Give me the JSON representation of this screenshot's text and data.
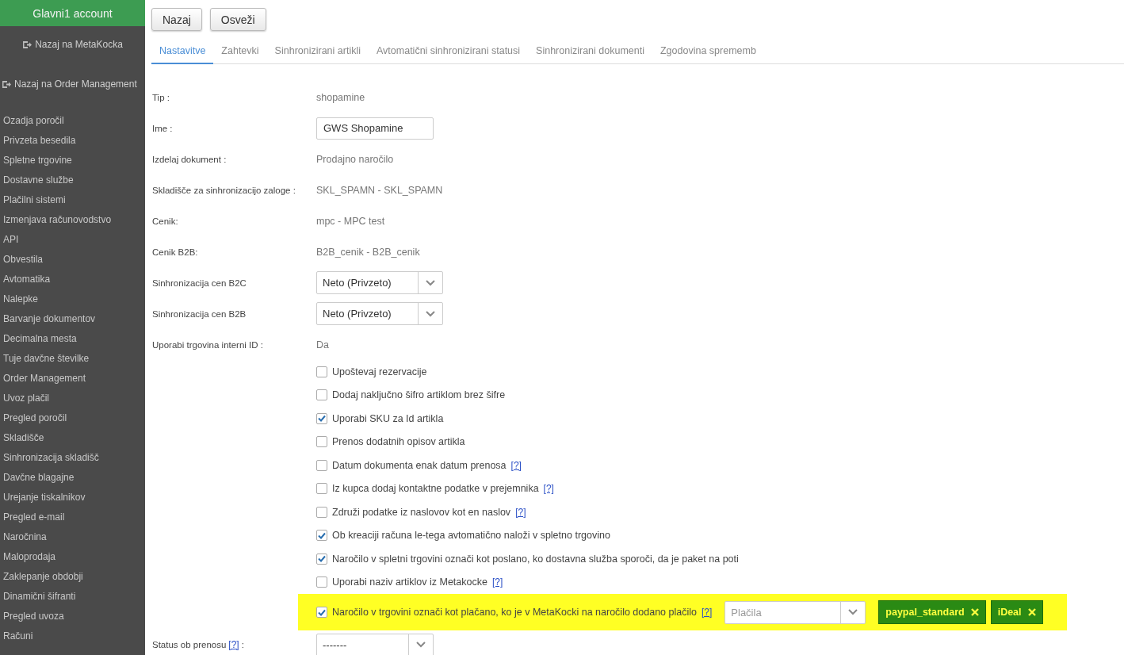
{
  "sidebar": {
    "account": "Glavni1 account",
    "back_links": [
      {
        "label": "Nazaj na MetaKocka"
      },
      {
        "label": "Nazaj na Order Management"
      }
    ],
    "items": [
      {
        "label": "Ozadja poročil"
      },
      {
        "label": "Privzeta besedila"
      },
      {
        "label": "Spletne trgovine"
      },
      {
        "label": "Dostavne službe"
      },
      {
        "label": "Plačilni sistemi"
      },
      {
        "label": "Izmenjava računovodstvo"
      },
      {
        "label": "API"
      },
      {
        "label": "Obvestila"
      },
      {
        "label": "Avtomatika"
      },
      {
        "label": "Nalepke"
      },
      {
        "label": "Barvanje dokumentov"
      },
      {
        "label": "Decimalna mesta"
      },
      {
        "label": "Tuje davčne številke"
      },
      {
        "label": "Order Management"
      },
      {
        "label": "Uvoz plačil"
      },
      {
        "label": "Pregled poročil"
      },
      {
        "label": "Skladišče"
      },
      {
        "label": "Sinhronizacija skladišč"
      },
      {
        "label": "Davčne blagajne"
      },
      {
        "label": "Urejanje tiskalnikov"
      },
      {
        "label": "Pregled e-mail"
      },
      {
        "label": "Naročnina"
      },
      {
        "label": "Maloprodaja"
      },
      {
        "label": "Zaklepanje obdobji"
      },
      {
        "label": "Dinamični šifranti"
      },
      {
        "label": "Pregled uvoza"
      },
      {
        "label": "Računi"
      }
    ]
  },
  "toolbar": {
    "buttons": [
      "Nazaj",
      "Osveži"
    ]
  },
  "tabs": [
    {
      "label": "Nastavitve",
      "selected": true
    },
    {
      "label": "Zahtevki",
      "selected": false
    },
    {
      "label": "Sinhronizirani artikli",
      "selected": false
    },
    {
      "label": "Avtomatični sinhronizirani statusi",
      "selected": false
    },
    {
      "label": "Sinhronizirani dokumenti",
      "selected": false
    },
    {
      "label": "Zgodovina sprememb",
      "selected": false
    }
  ],
  "fields": [
    {
      "kind": "text",
      "label": "Tip :",
      "value": "shopamine"
    },
    {
      "kind": "input",
      "label": "Ime :",
      "value": "GWS Shopamine"
    },
    {
      "kind": "text",
      "label": "Izdelaj dokument :",
      "value": "Prodajno naročilo"
    },
    {
      "kind": "text",
      "label": "Skladišče za sinhronizacijo zaloge :",
      "value": "SKL_SPAMN - SKL_SPAMN"
    },
    {
      "kind": "text",
      "label": "Cenik:",
      "value": "mpc - MPC test"
    },
    {
      "kind": "text",
      "label": "Cenik B2B:",
      "value": "B2B_cenik - B2B_cenik"
    },
    {
      "kind": "select",
      "label": "Sinhronizacija cen B2C",
      "value": "Neto (Privzeto)"
    },
    {
      "kind": "select",
      "label": "Sinhronizacija cen B2B",
      "value": "Neto (Privzeto)"
    },
    {
      "kind": "text",
      "label": "Uporabi trgovina interni ID :",
      "value": "Da"
    }
  ],
  "options": [
    {
      "label": "Upoštevaj rezervacije",
      "checked": false,
      "highlighted": false
    },
    {
      "label": "Dodaj naključno šifro artiklom brez šifre",
      "checked": false,
      "highlighted": false
    },
    {
      "label": "Uporabi SKU za Id artikla",
      "checked": true,
      "highlighted": false
    },
    {
      "label": "Prenos dodatnih opisov artikla",
      "checked": false,
      "highlighted": false
    },
    {
      "label": "Datum dokumenta enak datum prenosa",
      "help": "[?]",
      "checked": false,
      "highlighted": false
    },
    {
      "label": "Iz kupca dodaj kontaktne podatke v prejemnika",
      "help": "[?]",
      "checked": false,
      "highlighted": false
    },
    {
      "label": "Združi podatke iz naslovov kot en naslov",
      "help": "[?]",
      "checked": false,
      "highlighted": false
    },
    {
      "label": "Ob kreaciji računa le-tega avtomatično naloži v spletno trgovino",
      "checked": true,
      "highlighted": false
    },
    {
      "label": "Naročilo v spletni trgovini označi kot poslano, ko dostavna služba sporoči, da je paket na poti",
      "checked": true,
      "highlighted": false
    },
    {
      "label": "Uporabi naziv artiklov iz Metakocke",
      "help": "[?]",
      "checked": false,
      "highlighted": false
    },
    {
      "label": "Naročilo v trgovini označi kot plačano, ko je v MetaKocki na naročilo dodano plačilo",
      "help": "[?]",
      "checked": true,
      "highlighted": true,
      "payment_select": {
        "placeholder": "Plačila",
        "tags": [
          "paypal_standard",
          "iDeal"
        ]
      }
    }
  ],
  "status_field": {
    "label": "Status ob prenosu",
    "help": "[?]",
    "label_end": ":",
    "value": "-------"
  }
}
